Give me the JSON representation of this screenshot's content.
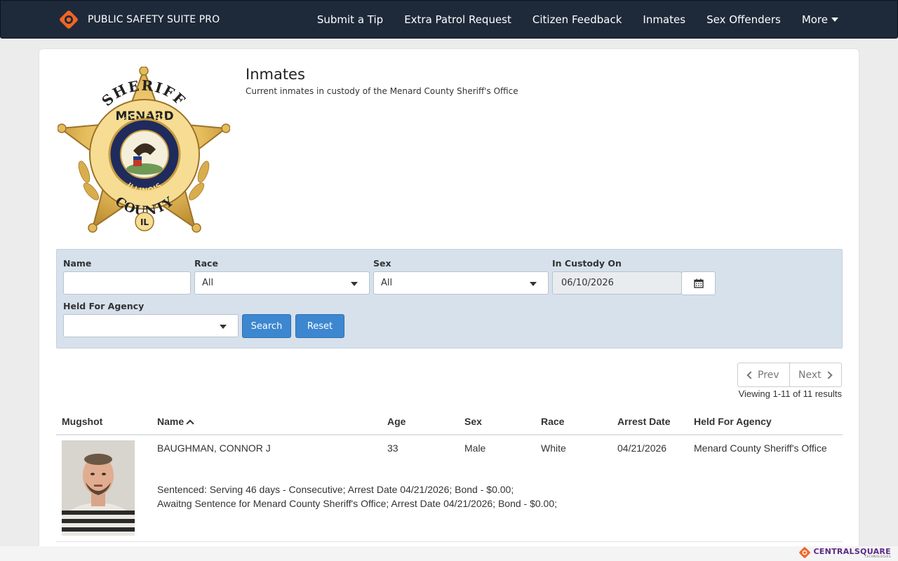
{
  "navbar": {
    "brand": "PUBLIC SAFETY SUITE PRO",
    "items": [
      {
        "label": "Submit a Tip"
      },
      {
        "label": "Extra Patrol Request"
      },
      {
        "label": "Citizen Feedback"
      },
      {
        "label": "Inmates"
      },
      {
        "label": "Sex Offenders"
      },
      {
        "label": "More"
      }
    ]
  },
  "badge": {
    "top_text": "SHERIFF",
    "county": "MENARD",
    "ring_top": "STATE OF",
    "ring_bottom": "ILLINOIS",
    "bottom_text": "COUNTY",
    "state": "IL"
  },
  "page": {
    "title": "Inmates",
    "subtitle": "Current inmates in custody of the Menard County Sheriff's Office"
  },
  "filters": {
    "name_label": "Name",
    "name_value": "",
    "race_label": "Race",
    "race_value": "All",
    "sex_label": "Sex",
    "sex_value": "All",
    "custody_label": "In Custody On",
    "custody_value": "06/10/2026",
    "agency_label": "Held For Agency",
    "agency_value": "",
    "search_label": "Search",
    "reset_label": "Reset"
  },
  "pager": {
    "prev_label": "Prev",
    "next_label": "Next",
    "results_text": "Viewing 1-11 of 11 results"
  },
  "table": {
    "headers": {
      "mugshot": "Mugshot",
      "name": "Name",
      "age": "Age",
      "sex": "Sex",
      "race": "Race",
      "arrest_date": "Arrest Date",
      "agency": "Held For Agency"
    },
    "rows": [
      {
        "name": "BAUGHMAN, CONNOR J",
        "age": "33",
        "sex": "Male",
        "race": "White",
        "arrest_date": "04/21/2026",
        "agency": "Menard County Sheriff's Office",
        "notes": [
          "Sentenced: Serving 46 days - Consecutive; Arrest Date 04/21/2026; Bond - $0.00;",
          "Awaitng Sentence for Menard County Sheriff's Office; Arrest Date 04/21/2026; Bond - $0.00;"
        ]
      }
    ]
  },
  "footer": {
    "brand": "CENTRALSQUARE",
    "tagline": "TECHNOLOGIES"
  },
  "colors": {
    "navbar_bg": "#1e2a3a",
    "accent_orange": "#f26522",
    "button_blue": "#3d87d0",
    "filter_panel_bg": "#d6e1ec",
    "footer_brand": "#5b2a86"
  },
  "icons": {
    "brand": "centralsquare-logo-icon",
    "calendar": "calendar-icon",
    "dropdown": "caret-down-icon",
    "sort": "sort-asc-icon"
  }
}
